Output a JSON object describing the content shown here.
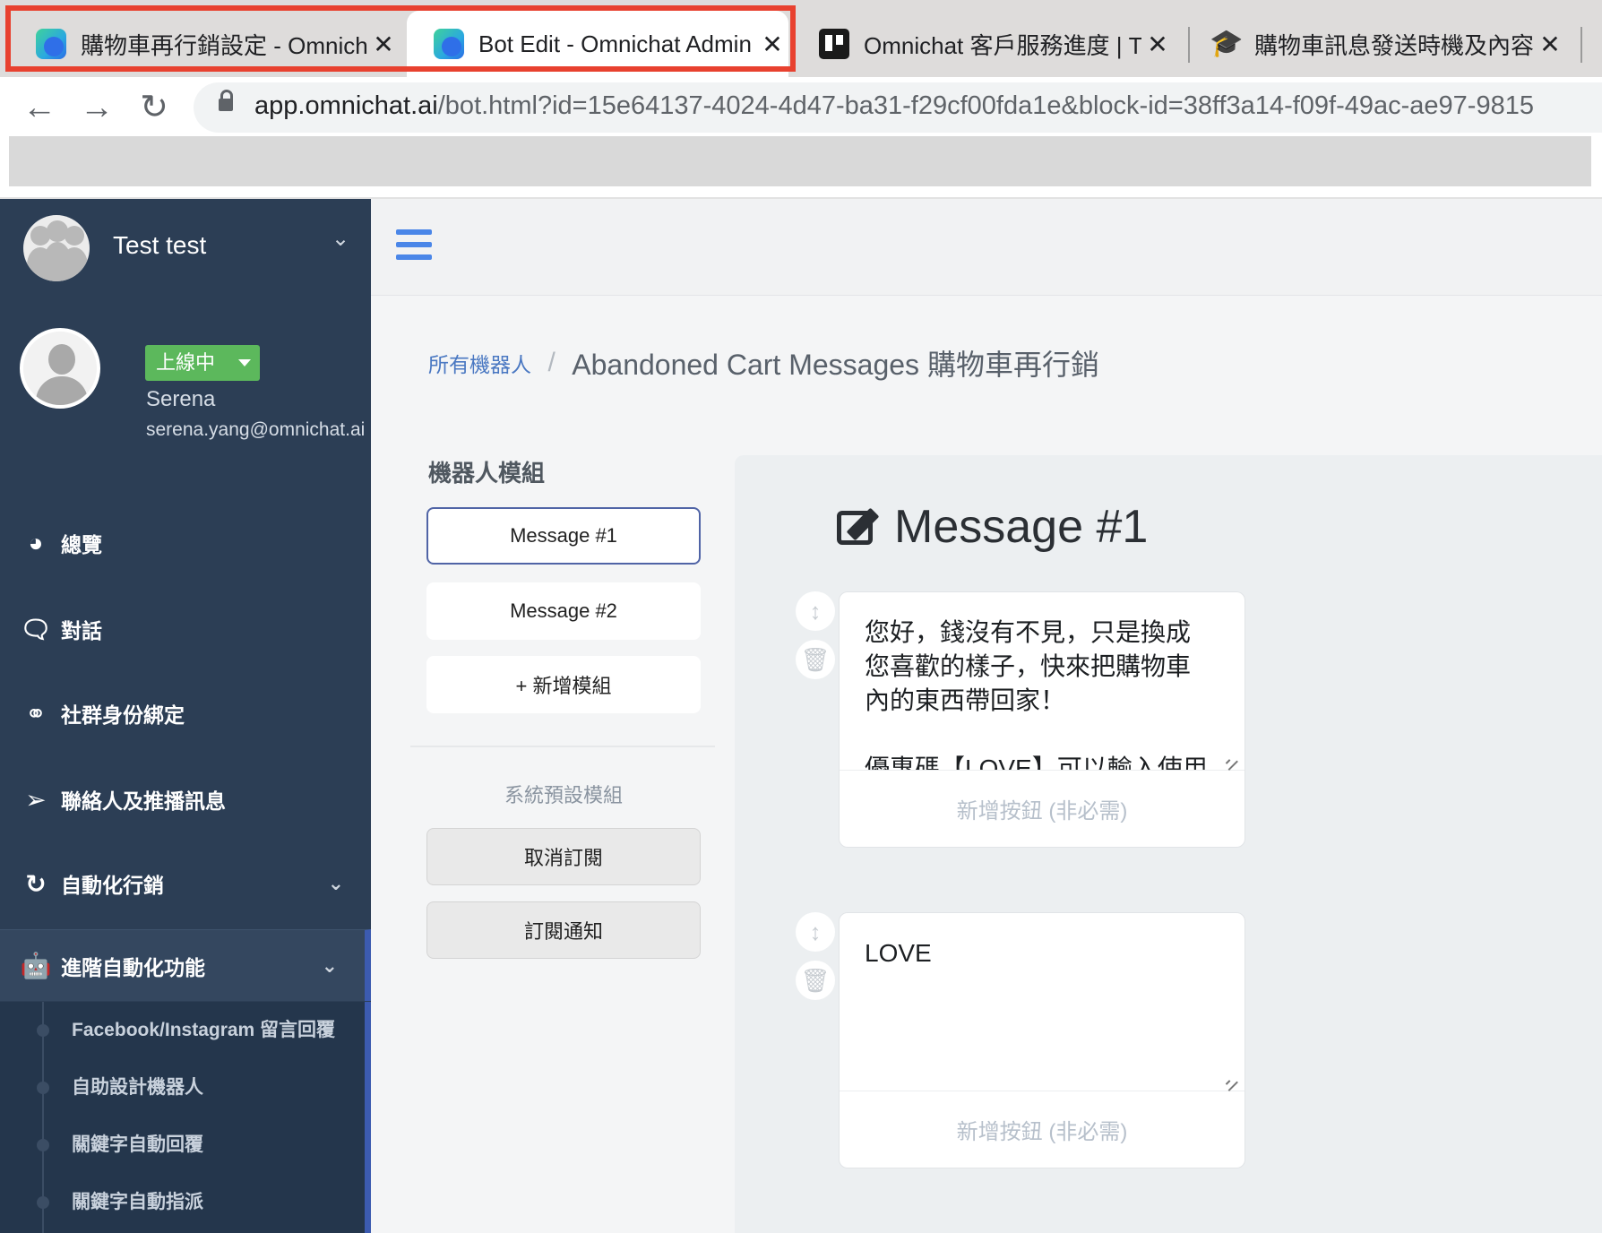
{
  "browser": {
    "tabs": [
      {
        "title": "購物車再行銷設定 - Omnicha",
        "favicon": "omnichat-logo",
        "active": false
      },
      {
        "title": "Bot Edit - Omnichat Admin",
        "favicon": "omnichat-logo",
        "active": true
      },
      {
        "title": "Omnichat 客戶服務進度 | Tre",
        "favicon": "trello-icon",
        "active": false
      },
      {
        "title": "購物車訊息發送時機及內容 -",
        "favicon": "graduation-cap-icon",
        "active": false
      }
    ],
    "close_glyph": "✕",
    "url_host": "app.omnichat.ai",
    "url_path": "/bot.html?id=15e64137-4024-4d47-ba31-f29cf00fda1e&block-id=38ff3a14-f09f-49ac-ae97-9815",
    "highlight_color": "#e8412f"
  },
  "sidebar": {
    "account_name": "Test test",
    "status_label": "上線中",
    "status_color": "#5cb85c",
    "user_name": "Serena",
    "user_email": "serena.yang@omnichat.ai",
    "menu": [
      {
        "label": "總覽",
        "icon": "dashboard-icon"
      },
      {
        "label": "對話",
        "icon": "chat-bubbles-icon"
      },
      {
        "label": "社群身份綁定",
        "icon": "link-icon"
      },
      {
        "label": "聯絡人及推播訊息",
        "icon": "paper-plane-icon"
      },
      {
        "label": "自動化行銷",
        "icon": "refresh-icon"
      },
      {
        "label": "進階自動化功能",
        "icon": "android-icon"
      }
    ],
    "submenu": [
      {
        "label": "Facebook/Instagram 留言回覆"
      },
      {
        "label": "自助設計機器人"
      },
      {
        "label": "關鍵字自動回覆"
      },
      {
        "label": "關鍵字自動指派"
      }
    ]
  },
  "main": {
    "breadcrumb": {
      "root": "所有機器人",
      "separator": "/",
      "current": "Abandoned Cart Messages 購物車再行銷"
    },
    "modules_title": "機器人模組",
    "modules": [
      "Message #1",
      "Message #2",
      "+ 新增模組"
    ],
    "system_title": "系統預設模組",
    "system_modules": [
      "取消訂閱",
      "訂閱通知"
    ],
    "editor": {
      "title": "Message #1",
      "messages": [
        {
          "text": "您好，錢沒有不見，只是換成\n您喜歡的樣子，快來把購物車\n內的東西帶回家！\n\n優惠碼【LOVE】可以輸入使用",
          "button_placeholder": "新增按鈕 (非必需)"
        },
        {
          "text": "LOVE",
          "button_placeholder": "新增按鈕 (非必需)"
        }
      ]
    },
    "accent_color": "#4a86e8"
  }
}
